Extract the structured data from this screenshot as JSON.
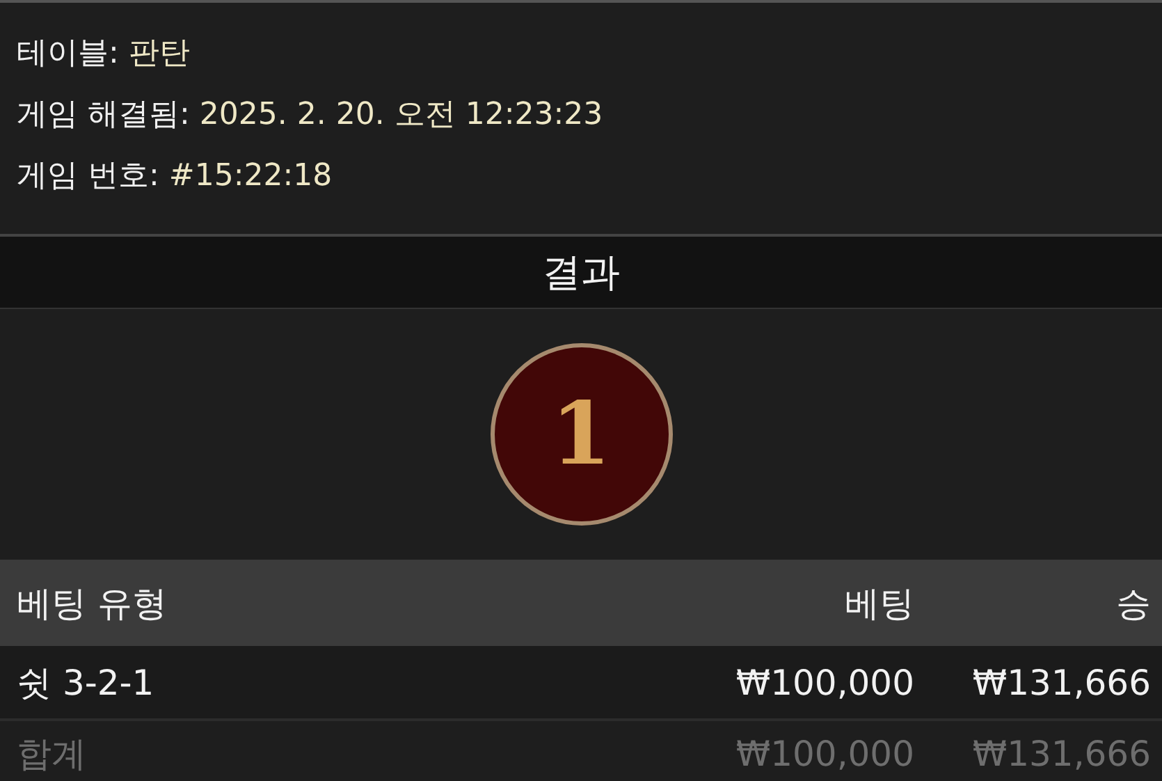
{
  "details": [
    {
      "label": "테이블:",
      "value": "판탄"
    },
    {
      "label": "게임 해결됨:",
      "value": "2025. 2. 20. 오전 12:23:23"
    },
    {
      "label": "게임 번호:",
      "value": "#15:22:18"
    }
  ],
  "result": {
    "title": "결과",
    "number": "1"
  },
  "table": {
    "columns": [
      "베팅 유형",
      "베팅",
      "승"
    ],
    "rows": [
      {
        "kind": "bet",
        "cells": [
          "쉿 3-2-1",
          "₩100,000",
          "₩131,666"
        ]
      },
      {
        "kind": "total",
        "cells": [
          "합계",
          "₩100,000",
          "₩131,666"
        ]
      }
    ]
  }
}
